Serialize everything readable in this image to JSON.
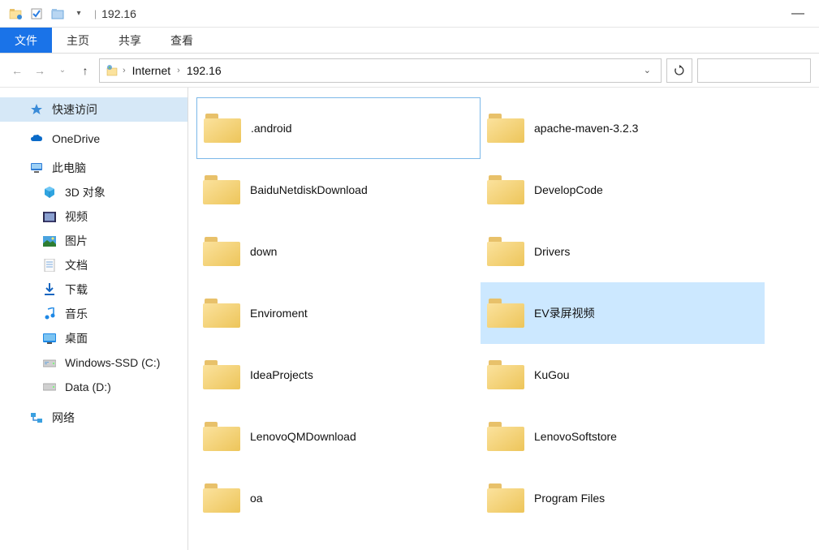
{
  "title": "192.16",
  "quickAccessTools": [
    "explorer",
    "checkbox",
    "folder",
    "dropdown"
  ],
  "tabs": {
    "file": "文件",
    "home": "主页",
    "share": "共享",
    "view": "查看"
  },
  "breadcrumbs": [
    "Internet",
    "192.16"
  ],
  "sidebar": {
    "quickAccess": "快速访问",
    "onedrive": "OneDrive",
    "thisPC": "此电脑",
    "objects3d": "3D 对象",
    "videos": "视频",
    "pictures": "图片",
    "documents": "文档",
    "downloads": "下载",
    "music": "音乐",
    "desktop": "桌面",
    "driveC": "Windows-SSD (C:)",
    "driveD": "Data (D:)",
    "network": "网络"
  },
  "folders": [
    {
      "name": ".android",
      "state": "selected"
    },
    {
      "name": "apache-maven-3.2.3",
      "state": ""
    },
    {
      "name": "BaiduNetdiskDownload",
      "state": ""
    },
    {
      "name": "DevelopCode",
      "state": ""
    },
    {
      "name": "down",
      "state": ""
    },
    {
      "name": "Drivers",
      "state": ""
    },
    {
      "name": "Enviroment",
      "state": ""
    },
    {
      "name": "EV录屏视频",
      "state": "hovered"
    },
    {
      "name": "IdeaProjects",
      "state": ""
    },
    {
      "name": "KuGou",
      "state": ""
    },
    {
      "name": "LenovoQMDownload",
      "state": ""
    },
    {
      "name": "LenovoSoftstore",
      "state": ""
    },
    {
      "name": "oa",
      "state": ""
    },
    {
      "name": "Program Files",
      "state": ""
    }
  ]
}
